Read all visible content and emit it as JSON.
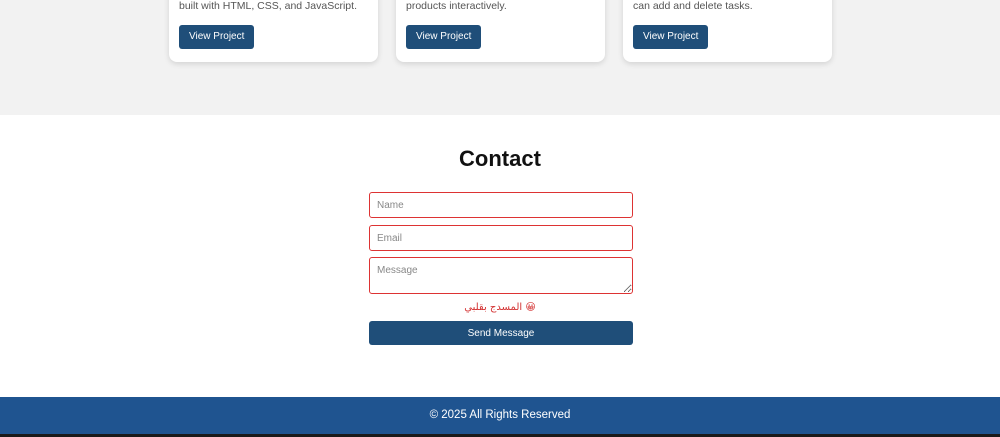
{
  "projects": {
    "cards": [
      {
        "description": "built with HTML, CSS, and JavaScript.",
        "button_label": "View Project"
      },
      {
        "description": "products interactively.",
        "button_label": "View Project"
      },
      {
        "description": "can add and delete tasks.",
        "button_label": "View Project"
      }
    ]
  },
  "contact": {
    "title": "Contact",
    "name_placeholder": "Name",
    "email_placeholder": "Email",
    "message_placeholder": "Message",
    "status_text": "😀 المسدج بقلبي",
    "send_label": "Send Message"
  },
  "footer": {
    "text": "© 2025 All Rights Reserved"
  },
  "colors": {
    "primary_button": "#1f4e79",
    "footer_bg": "#1f5490",
    "error_border": "#dd3333",
    "status_text": "#d32f2f"
  }
}
